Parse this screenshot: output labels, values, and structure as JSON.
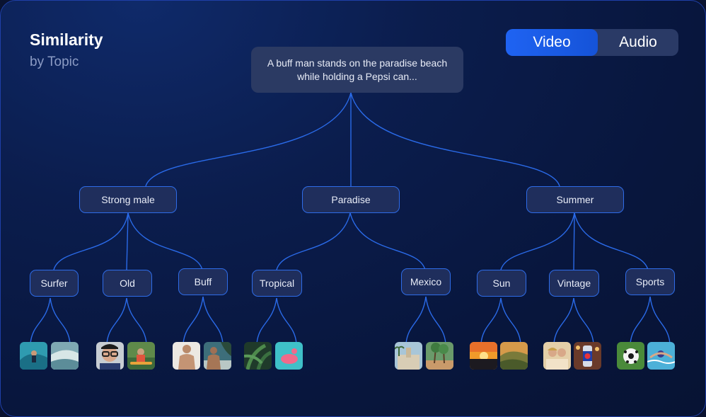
{
  "header": {
    "title": "Similarity",
    "subtitle": "by Topic"
  },
  "toggle": {
    "video_label": "Video",
    "audio_label": "Audio",
    "selected": "Video"
  },
  "root": {
    "text": "A buff man stands on the paradise beach while holding a Pepsi can..."
  },
  "topics": [
    {
      "label": "Strong male",
      "children": [
        "Surfer",
        "Old",
        "Buff"
      ]
    },
    {
      "label": "Paradise",
      "children": [
        "Tropical",
        "Mexico"
      ]
    },
    {
      "label": "Summer",
      "children": [
        "Sun",
        "Vintage",
        "Sports"
      ]
    }
  ],
  "thumbnails": {
    "Surfer": [
      "surf-wave-image",
      "ocean-wave-image"
    ],
    "Old": [
      "old-man-glasses-image",
      "kayak-person-image"
    ],
    "Buff": [
      "shirtless-man-image",
      "beach-man-image"
    ],
    "Tropical": [
      "palm-leaves-image",
      "pool-float-image"
    ],
    "Mexico": [
      "plaza-image",
      "palm-trees-image"
    ],
    "Sun": [
      "sunset-image",
      "hills-image"
    ],
    "Vintage": [
      "vintage-couple-image",
      "pepsi-can-image"
    ],
    "Sports": [
      "soccer-ball-image",
      "swimmer-image"
    ]
  },
  "colors": {
    "accent": "#1f63f2",
    "line": "#2a6ae8",
    "node_bg": "#1f2e5c"
  }
}
